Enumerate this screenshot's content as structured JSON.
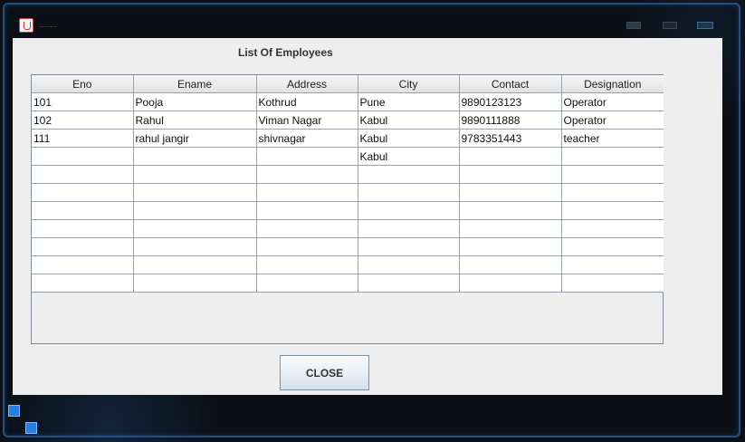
{
  "window": {
    "title": "........"
  },
  "heading": "List Of Employees",
  "table": {
    "columns": [
      "Eno",
      "Ename",
      "Address",
      "City",
      "Contact",
      "Designation"
    ],
    "rows": [
      [
        "101",
        "Pooja",
        "Kothrud",
        "Pune",
        "9890123123",
        "Operator"
      ],
      [
        "102",
        "Rahul",
        "Viman Nagar",
        "Kabul",
        "9890111888",
        "Operator"
      ],
      [
        "111",
        "rahul jangir",
        "shivnagar",
        "Kabul",
        "9783351443",
        "teacher"
      ],
      [
        "",
        "",
        "",
        "Kabul",
        "",
        ""
      ],
      [
        "",
        "",
        "",
        "",
        "",
        ""
      ],
      [
        "",
        "",
        "",
        "",
        "",
        ""
      ],
      [
        "",
        "",
        "",
        "",
        "",
        ""
      ],
      [
        "",
        "",
        "",
        "",
        "",
        ""
      ],
      [
        "",
        "",
        "",
        "",
        "",
        ""
      ],
      [
        "",
        "",
        "",
        "",
        "",
        ""
      ],
      [
        "",
        "",
        "",
        "",
        "",
        ""
      ]
    ]
  },
  "buttons": {
    "close_label": "CLOSE"
  },
  "colors": {
    "frame_accent": "#2a7de0",
    "content_bg": "#eeeeee"
  }
}
